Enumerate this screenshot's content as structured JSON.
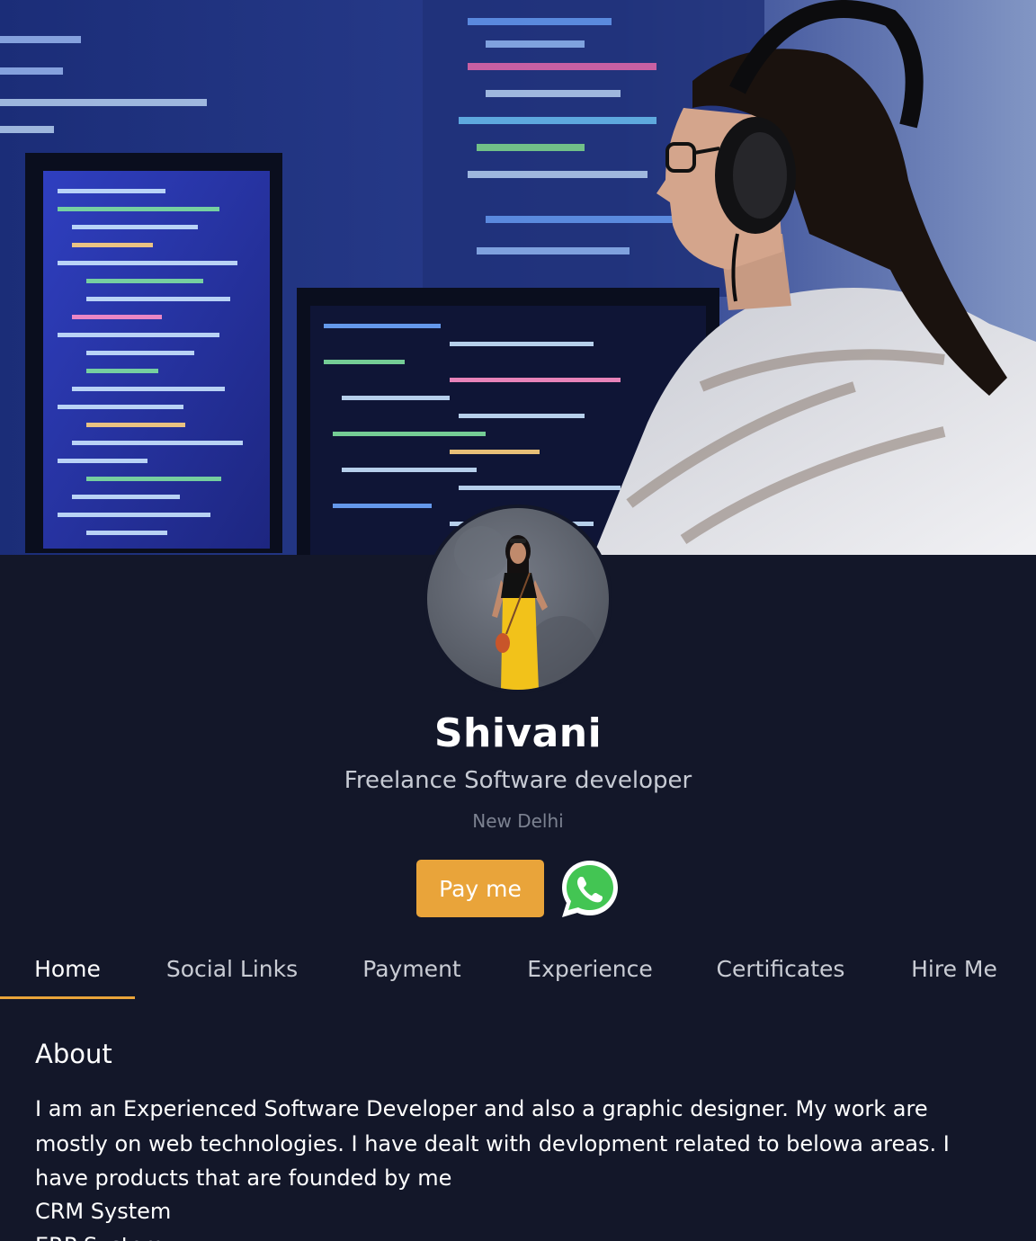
{
  "profile": {
    "name": "Shivani",
    "title": "Freelance Software developer",
    "location": "New Delhi"
  },
  "actions": {
    "pay_label": "Pay me",
    "whatsapp_icon": "whatsapp-icon",
    "accent_color": "#e9a43a",
    "whatsapp_color": "#43c553"
  },
  "tabs": [
    {
      "label": "Home",
      "active": true
    },
    {
      "label": "Social Links",
      "active": false
    },
    {
      "label": "Payment",
      "active": false
    },
    {
      "label": "Experience",
      "active": false
    },
    {
      "label": "Certificates",
      "active": false
    },
    {
      "label": "Hire Me",
      "active": false
    }
  ],
  "about": {
    "heading": "About",
    "text": "I am an Experienced Software Developer and also a graphic designer. My work are mostly on web technologies. I have dealt with devlopment related to belowa areas. I have products that are founded by me",
    "products": [
      "CRM System",
      "ERP System"
    ]
  },
  "colors": {
    "background": "#131729",
    "text_muted": "#7c8291"
  }
}
